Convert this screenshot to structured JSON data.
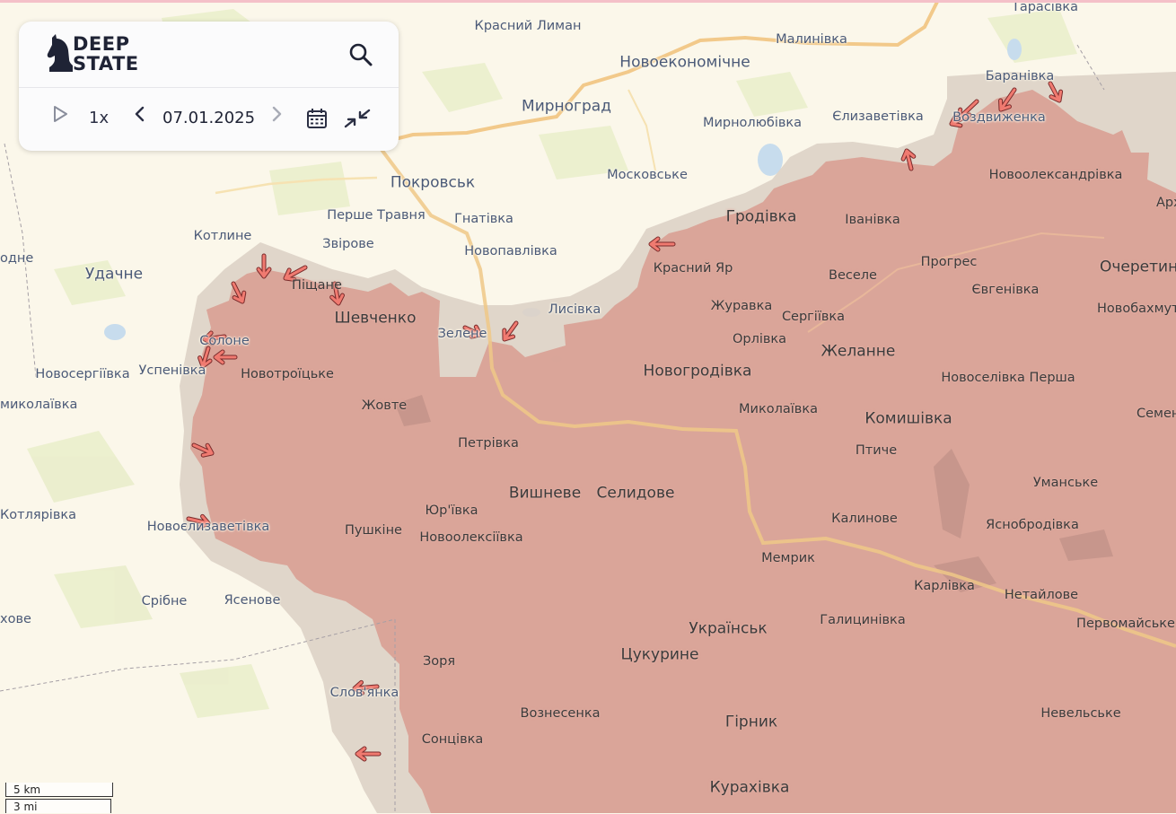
{
  "app": {
    "brand_line1": "DEEP",
    "brand_line2": "STATE"
  },
  "controls": {
    "speed": "1x",
    "date": "07.01.2025",
    "icons": [
      "play-icon",
      "chevron-left-icon",
      "chevron-right-icon",
      "calendar-icon",
      "compress-arrows-icon",
      "search-icon",
      "deepstate-knight-logo"
    ]
  },
  "scale": {
    "km": "5 km",
    "mi": "3 mi"
  },
  "colors": {
    "map_background": "#fbf7ea",
    "occupied_area": "#d9a195",
    "contested_zone": "#ddd2c6",
    "attack_arrow": "#f07a70",
    "highway": "#f2c98a",
    "label_text": "#4a5a78"
  },
  "places": [
    {
      "name": "Тарасівка",
      "kind": "small",
      "zone": "free"
    },
    {
      "name": "Красний Лиман",
      "kind": "small",
      "zone": "free"
    },
    {
      "name": "Малинівка",
      "kind": "small",
      "zone": "free"
    },
    {
      "name": "Новоекономічне",
      "kind": "town",
      "zone": "free"
    },
    {
      "name": "Баранівка",
      "kind": "small",
      "zone": "free"
    },
    {
      "name": "Мирноград",
      "kind": "town",
      "zone": "free"
    },
    {
      "name": "Мирнолюбівка",
      "kind": "small",
      "zone": "free"
    },
    {
      "name": "Єлизаветівка",
      "kind": "small",
      "zone": "free"
    },
    {
      "name": "Воздвиженка",
      "kind": "small",
      "zone": "free"
    },
    {
      "name": "Московське",
      "kind": "small",
      "zone": "free"
    },
    {
      "name": "Новоолександрівка",
      "kind": "small",
      "zone": "occupied"
    },
    {
      "name": "Покровськ",
      "kind": "town",
      "zone": "free"
    },
    {
      "name": "Архан",
      "kind": "small",
      "zone": "occupied"
    },
    {
      "name": "Перше Травня",
      "kind": "small",
      "zone": "free"
    },
    {
      "name": "Гнатівка",
      "kind": "small",
      "zone": "free"
    },
    {
      "name": "Гродівка",
      "kind": "town",
      "zone": "occupied"
    },
    {
      "name": "Іванівка",
      "kind": "small",
      "zone": "occupied"
    },
    {
      "name": "Котлине",
      "kind": "small",
      "zone": "free"
    },
    {
      "name": "Звірове",
      "kind": "small",
      "zone": "free"
    },
    {
      "name": "Новопавлівка",
      "kind": "small",
      "zone": "free"
    },
    {
      "name": "одне",
      "kind": "small",
      "zone": "free"
    },
    {
      "name": "Прогрес",
      "kind": "small",
      "zone": "occupied"
    },
    {
      "name": "Очеретин",
      "kind": "town",
      "zone": "occupied"
    },
    {
      "name": "Удачне",
      "kind": "town",
      "zone": "free"
    },
    {
      "name": "Красний Яр",
      "kind": "small",
      "zone": "occupied"
    },
    {
      "name": "Веселе",
      "kind": "small",
      "zone": "occupied"
    },
    {
      "name": "Піщане",
      "kind": "small",
      "zone": "occupied"
    },
    {
      "name": "Євгенівка",
      "kind": "small",
      "zone": "occupied"
    },
    {
      "name": "Новобахмут",
      "kind": "small",
      "zone": "occupied"
    },
    {
      "name": "Журавка",
      "kind": "small",
      "zone": "occupied"
    },
    {
      "name": "Лисівка",
      "kind": "small",
      "zone": "free"
    },
    {
      "name": "Шевченко",
      "kind": "town",
      "zone": "occupied"
    },
    {
      "name": "Сергіївка",
      "kind": "small",
      "zone": "occupied"
    },
    {
      "name": "Зелене",
      "kind": "small",
      "zone": "contested"
    },
    {
      "name": "Солоне",
      "kind": "small",
      "zone": "contested"
    },
    {
      "name": "Орлівка",
      "kind": "small",
      "zone": "occupied"
    },
    {
      "name": "Желанне",
      "kind": "town",
      "zone": "occupied"
    },
    {
      "name": "Новосергіївка",
      "kind": "small",
      "zone": "free"
    },
    {
      "name": "Успенівка",
      "kind": "small",
      "zone": "free"
    },
    {
      "name": "Новотроїцьке",
      "kind": "small",
      "zone": "occupied"
    },
    {
      "name": "Новогродівка",
      "kind": "town",
      "zone": "occupied"
    },
    {
      "name": "Новоселівка Перша",
      "kind": "small",
      "zone": "occupied"
    },
    {
      "name": "миколаївка",
      "kind": "small",
      "zone": "free"
    },
    {
      "name": "Жовте",
      "kind": "small",
      "zone": "occupied"
    },
    {
      "name": "Миколаївка",
      "kind": "small",
      "zone": "occupied"
    },
    {
      "name": "Комишівка",
      "kind": "town",
      "zone": "occupied"
    },
    {
      "name": "Семен",
      "kind": "small",
      "zone": "occupied"
    },
    {
      "name": "Петрівка",
      "kind": "small",
      "zone": "occupied"
    },
    {
      "name": "Птиче",
      "kind": "small",
      "zone": "occupied"
    },
    {
      "name": "Вишневе",
      "kind": "town",
      "zone": "occupied"
    },
    {
      "name": "Селидове",
      "kind": "town",
      "zone": "occupied"
    },
    {
      "name": "Уманське",
      "kind": "small",
      "zone": "occupied"
    },
    {
      "name": "Котлярівка",
      "kind": "small",
      "zone": "free"
    },
    {
      "name": "Юр'ївка",
      "kind": "small",
      "zone": "occupied"
    },
    {
      "name": "Калинове",
      "kind": "small",
      "zone": "occupied"
    },
    {
      "name": "Новоєлизаветівка",
      "kind": "small",
      "zone": "contested"
    },
    {
      "name": "Пушкіне",
      "kind": "small",
      "zone": "occupied"
    },
    {
      "name": "Яснобродівка",
      "kind": "small",
      "zone": "occupied"
    },
    {
      "name": "Новоолексіївка",
      "kind": "small",
      "zone": "occupied"
    },
    {
      "name": "Мемрик",
      "kind": "small",
      "zone": "occupied"
    },
    {
      "name": "Карлівка",
      "kind": "small",
      "zone": "occupied"
    },
    {
      "name": "Нетайлове",
      "kind": "small",
      "zone": "occupied"
    },
    {
      "name": "Срібне",
      "kind": "small",
      "zone": "free"
    },
    {
      "name": "Ясенове",
      "kind": "small",
      "zone": "free"
    },
    {
      "name": "хове",
      "kind": "small",
      "zone": "free"
    },
    {
      "name": "Галицинівка",
      "kind": "small",
      "zone": "occupied"
    },
    {
      "name": "Первомайське",
      "kind": "small",
      "zone": "occupied"
    },
    {
      "name": "Українськ",
      "kind": "town",
      "zone": "occupied"
    },
    {
      "name": "Цукурине",
      "kind": "town",
      "zone": "occupied"
    },
    {
      "name": "Зоря",
      "kind": "small",
      "zone": "occupied"
    },
    {
      "name": "Слов'янка",
      "kind": "small",
      "zone": "contested"
    },
    {
      "name": "Вознесенка",
      "kind": "small",
      "zone": "occupied"
    },
    {
      "name": "Гірник",
      "kind": "town",
      "zone": "occupied"
    },
    {
      "name": "Невельське",
      "kind": "small",
      "zone": "occupied"
    },
    {
      "name": "Сонцівка",
      "kind": "small",
      "zone": "occupied"
    },
    {
      "name": "Курахівка",
      "kind": "town",
      "zone": "occupied"
    }
  ]
}
